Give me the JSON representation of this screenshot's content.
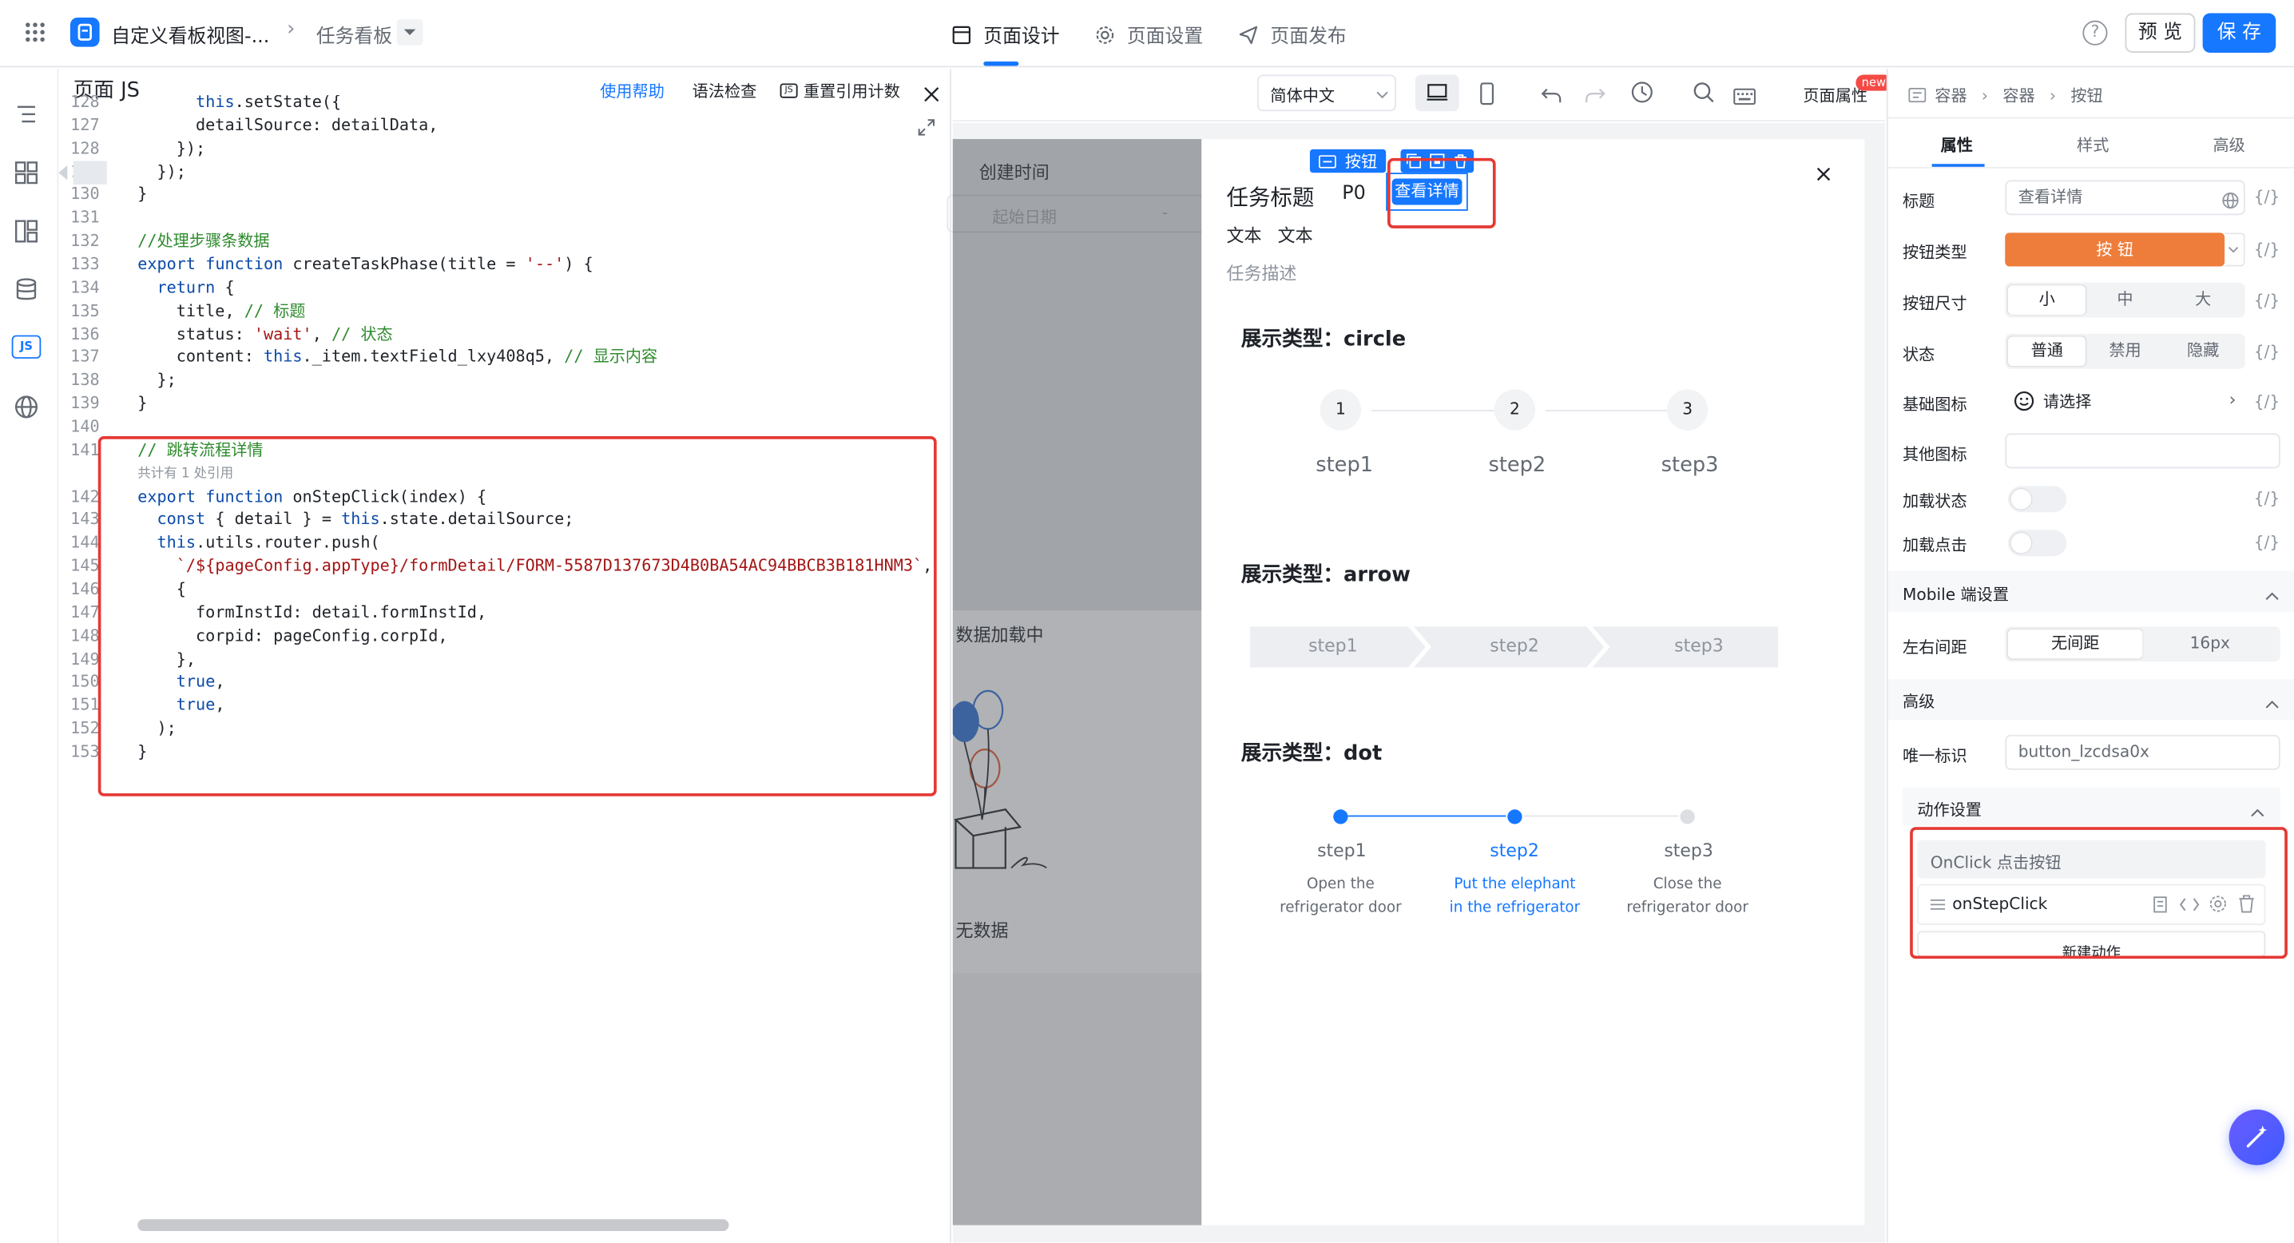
{
  "header": {
    "app_title": "自定义看板视图-...",
    "breadcrumb": "任务看板",
    "tabs": [
      {
        "label": "页面设计",
        "active": true
      },
      {
        "label": "页面设置",
        "active": false
      },
      {
        "label": "页面发布",
        "active": false
      }
    ],
    "preview_label": "预 览",
    "save_label": "保 存"
  },
  "js_panel": {
    "title": "页面 JS",
    "help_label": "使用帮助",
    "syntax_label": "语法检查",
    "reset_label": "重置引用计数",
    "reference_hint": "共计有 1 处引用",
    "lines": [
      {
        "n": "128",
        "text": "      this.setState({"
      },
      {
        "n": "127",
        "text": "      detailSource: detailData,"
      },
      {
        "n": "128",
        "text": "    });"
      },
      {
        "n": "129",
        "text": "  });"
      },
      {
        "n": "130",
        "text": "}"
      },
      {
        "n": "131",
        "text": ""
      },
      {
        "n": "132",
        "text": "//处理步骤条数据"
      },
      {
        "n": "133",
        "text": "export function createTaskPhase(title = '--') {"
      },
      {
        "n": "134",
        "text": "  return {"
      },
      {
        "n": "135",
        "text": "    title, // 标题"
      },
      {
        "n": "136",
        "text": "    status: 'wait', // 状态"
      },
      {
        "n": "137",
        "text": "    content: this._item.textField_lxy408q5, // 显示内容"
      },
      {
        "n": "138",
        "text": "  };"
      },
      {
        "n": "139",
        "text": "}"
      },
      {
        "n": "140",
        "text": ""
      },
      {
        "n": "141",
        "text": "// 跳转流程详情"
      },
      {
        "n": "142",
        "text": "export function onStepClick(index) {"
      },
      {
        "n": "143",
        "text": "  const { detail } = this.state.detailSource;"
      },
      {
        "n": "144",
        "text": "  this.utils.router.push("
      },
      {
        "n": "145",
        "text": "    `/${pageConfig.appType}/formDetail/FORM-5587D137673D4B0BA54AC94BBCB3B181HNM3`,"
      },
      {
        "n": "146",
        "text": "    {"
      },
      {
        "n": "147",
        "text": "      formInstId: detail.formInstId,"
      },
      {
        "n": "148",
        "text": "      corpid: pageConfig.corpId,"
      },
      {
        "n": "149",
        "text": "    },"
      },
      {
        "n": "150",
        "text": "    true,"
      },
      {
        "n": "151",
        "text": "    true,"
      },
      {
        "n": "152",
        "text": "  );"
      },
      {
        "n": "153",
        "text": "}"
      }
    ]
  },
  "canvas_toolbar": {
    "language": "简体中文",
    "page_props_label": "页面属性",
    "new_badge": "new"
  },
  "canvas_bg": {
    "create_time_label": "创建时间",
    "start_date_placeholder": "起始日期",
    "loading_text": "数据加载中",
    "empty_text": "无数据"
  },
  "dialog": {
    "selection_tag": "按钮",
    "task_title": "任务标题",
    "priority": "P0",
    "view_button_label": "查看详情",
    "text_1": "文本",
    "text_2": "文本",
    "task_desc": "任务描述",
    "sections": [
      {
        "title": "展示类型：circle"
      },
      {
        "title": "展示类型：arrow"
      },
      {
        "title": "展示类型：dot"
      }
    ],
    "circle_steps": [
      {
        "num": "1",
        "label": "step1"
      },
      {
        "num": "2",
        "label": "step2"
      },
      {
        "num": "3",
        "label": "step3"
      }
    ],
    "arrow_steps": [
      "step1",
      "step2",
      "step3"
    ],
    "dot_steps": [
      {
        "label": "step1",
        "desc1": "Open the",
        "desc2": "refrigerator door",
        "active": false
      },
      {
        "label": "step2",
        "desc1": "Put the elephant",
        "desc2": "in the refrigerator",
        "active": true
      },
      {
        "label": "step3",
        "desc1": "Close the",
        "desc2": "refrigerator door",
        "active": false
      }
    ]
  },
  "props_panel": {
    "breadcrumb": [
      "容器",
      "容器",
      "按钮"
    ],
    "tabs": [
      "属性",
      "样式",
      "高级"
    ],
    "title_label": "标题",
    "title_value": "查看详情",
    "btn_type_label": "按钮类型",
    "btn_type_value": "按 钮",
    "btn_size_label": "按钮尺寸",
    "sizes": [
      "小",
      "中",
      "大"
    ],
    "state_label": "状态",
    "states": [
      "普通",
      "禁用",
      "隐藏"
    ],
    "base_icon_label": "基础图标",
    "base_icon_value": "请选择",
    "other_icon_label": "其他图标",
    "loading_label": "加载状态",
    "loading_click_label": "加载点击",
    "mobile_section": "Mobile 端设置",
    "margin_label": "左右间距",
    "margins": [
      "无间距",
      "16px"
    ],
    "advanced_section": "高级",
    "uid_label": "唯一标识",
    "uid_value": "button_lzcdsa0x",
    "action_section": "动作设置",
    "onclick_label": "OnClick 点击按钮",
    "handler_name": "onStepClick",
    "new_action_label": "新建动作",
    "bind_symbol": "{/}"
  },
  "colors": {
    "primary": "#1677ff",
    "orange": "#ee7d3c",
    "highlight": "#e53935"
  }
}
